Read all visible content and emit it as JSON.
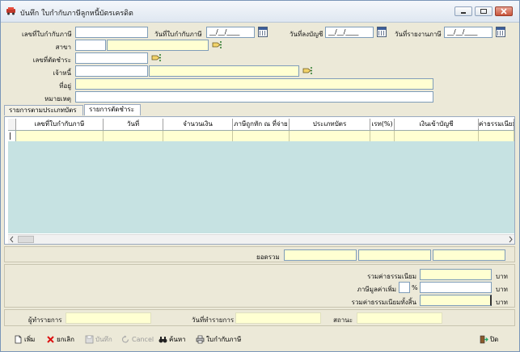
{
  "window": {
    "title": "บันทึก ใบกำกับภาษีลูกหนี้บัตรเครดิต"
  },
  "form": {
    "tax_invoice_no_label": "เลขที่ใบกำกับภาษี",
    "tax_invoice_no_value": "",
    "tax_invoice_date_label": "วันที่ใบกำกับภาษี",
    "tax_invoice_date_value": "__/__/____",
    "posting_date_label": "วันที่ลงบัญชี",
    "posting_date_value": "__/__/____",
    "report_date_label": "วันที่รายงานภาษี",
    "report_date_value": "__/__/____",
    "branch_label": "สาขา",
    "branch_code": "",
    "branch_name": "",
    "settle_no_label": "เลขที่ตัดชำระ",
    "settle_no_value": "",
    "creditor_label": "เจ้าหนี้",
    "creditor_code": "",
    "creditor_name": "",
    "address_label": "ที่อยู่",
    "address_value": "",
    "remark_label": "หมายเหตุ",
    "remark_value": ""
  },
  "tabs": [
    {
      "label": "รายการตามประเภทบัตร"
    },
    {
      "label": "รายการตัดชำระ"
    }
  ],
  "grid": {
    "columns": [
      "เลขที่ใบกำกับภาษี",
      "วันที่",
      "จำนวนเงิน",
      "ภาษีถูกหัก ณ ที่จ่าย",
      "ประเภทบัตร",
      "เรท(%)",
      "เงินเข้าบัญชี",
      "ค่าธรรมเนียม"
    ]
  },
  "totals": {
    "sum_label": "ยอดรวม",
    "sum_values": [
      "",
      "",
      ""
    ],
    "fee_total_label": "รวมค่าธรรมเนียม",
    "fee_total_value": "",
    "vat_label": "ภาษีมูลค่าเพิ่ม",
    "vat_rate": "",
    "vat_pct_sign": "%",
    "vat_value": "",
    "fee_grand_label": "รวมค่าธรรมเนียมทั้งสิ้น",
    "fee_grand_value": "",
    "currency": "บาท"
  },
  "footer": {
    "maker_label": "ผู้ทำรายการ",
    "maker_value": "",
    "make_date_label": "วันที่ทำรายการ",
    "make_date_value": "",
    "status_label": "สถานะ",
    "status_value": ""
  },
  "toolbar": {
    "add": "เพิ่ม",
    "cancel_doc": "ยกเลิก",
    "save": "บันทึก",
    "cancel": "Cancel",
    "search": "ค้นหา",
    "print": "ใบกำกับภาษี",
    "close": "ปิด"
  },
  "colors": {
    "input_yellow": "#ffffd2",
    "grid_bg": "#c6e2e2"
  }
}
